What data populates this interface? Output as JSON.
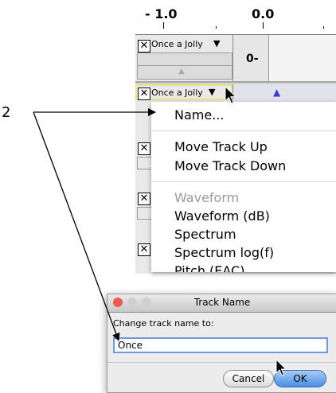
{
  "ruler": {
    "label_left": "- 1.0",
    "label_mid": "0.0"
  },
  "tracks": [
    {
      "name": "Once a Jolly",
      "scale_label": "0-"
    },
    {
      "name": "Once a Jolly"
    }
  ],
  "menu": {
    "items": [
      {
        "label": "Name...",
        "enabled": true
      },
      {
        "label": "Move Track Up",
        "enabled": true
      },
      {
        "label": "Move Track Down",
        "enabled": true
      },
      {
        "label": "Waveform",
        "enabled": false
      },
      {
        "label": "Waveform (dB)",
        "enabled": true
      },
      {
        "label": "Spectrum",
        "enabled": true
      },
      {
        "label": "Spectrum log(f)",
        "enabled": true
      },
      {
        "label": "Pitch (EAC)",
        "enabled": true
      }
    ]
  },
  "dialog": {
    "title": "Track Name",
    "prompt": "Change track name to:",
    "input_value": "Once",
    "cancel_label": "Cancel",
    "ok_label": "OK"
  },
  "callout": {
    "number": "2"
  },
  "colors": {
    "close_button": "#ee5a4f",
    "minimize_button": "#cfcfcf",
    "zoom_button": "#cfcfcf",
    "track_highlight": "#e9e38a",
    "input_focus": "#6b9bd8",
    "default_button": "#4a8ee6"
  }
}
